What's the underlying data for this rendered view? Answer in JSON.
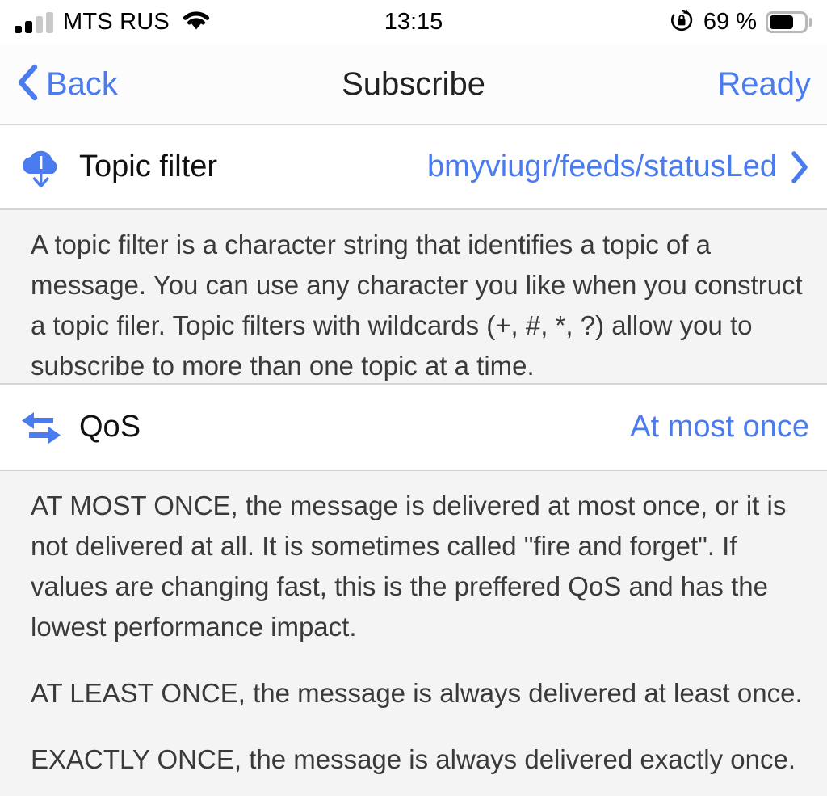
{
  "status_bar": {
    "carrier": "MTS RUS",
    "time": "13:15",
    "battery_percent": "69 %",
    "signal_icon": "cellular-signal-icon",
    "wifi_icon": "wifi-icon",
    "rotation_lock_icon": "rotation-lock-icon",
    "battery_icon": "battery-icon",
    "battery_level": 70,
    "signal_bars_filled": 2,
    "signal_bars_total": 4
  },
  "nav_bar": {
    "back_label": "Back",
    "back_icon": "chevron-left-icon",
    "title": "Subscribe",
    "action_label": "Ready"
  },
  "rows": {
    "topic_filter": {
      "icon": "cloud-download-icon",
      "label": "Topic filter",
      "value": "bmyviugr/feeds/statusLed",
      "chevron_icon": "chevron-right-icon"
    },
    "qos": {
      "icon": "exchange-arrows-icon",
      "label": "QoS",
      "value": "At most once"
    }
  },
  "notes": {
    "topic_filter": [
      "A topic filter is a character string that identifies a topic of a message. You can use any character you like when you construct a topic filer. Topic filters with wildcards (+, #, *, ?) allow you to subscribe to more than one topic at a time."
    ],
    "qos": [
      "AT MOST ONCE, the message is delivered at most once, or it is not delivered at all. It is sometimes called \"fire and forget\". If values are changing fast, this is the preffered QoS and has the lowest performance impact.",
      "AT LEAST ONCE, the message is always delivered at least once.",
      "EXACTLY ONCE, the message is always delivered exactly once."
    ]
  },
  "colors": {
    "accent_blue": "#4a7cf0",
    "text_primary": "#111111",
    "text_note": "#3a3a3a",
    "section_bg": "#f4f4f4",
    "separator": "#d5d5d5"
  }
}
